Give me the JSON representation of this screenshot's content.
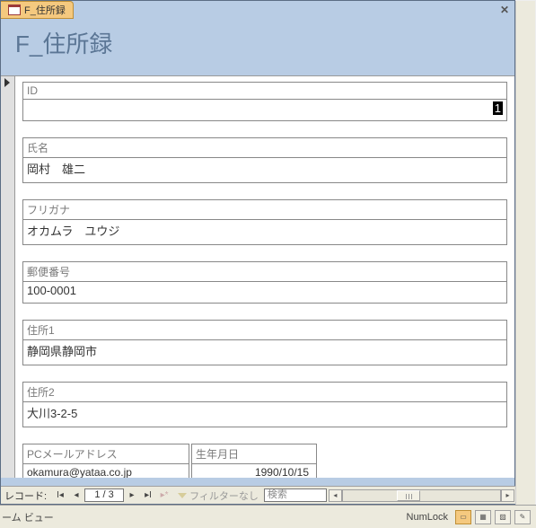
{
  "tab": {
    "title": "F_住所録"
  },
  "form": {
    "title": "F_住所録"
  },
  "fields": {
    "id": {
      "label": "ID",
      "value": "1"
    },
    "name": {
      "label": "氏名",
      "value": "岡村　雄二"
    },
    "furigana": {
      "label": "フリガナ",
      "value": "オカムラ　ユウジ"
    },
    "postal": {
      "label": "郵便番号",
      "value": "100-0001"
    },
    "addr1": {
      "label": "住所1",
      "value": "静岡県静岡市"
    },
    "addr2": {
      "label": "住所2",
      "value": "大川3-2-5"
    },
    "email": {
      "label": "PCメールアドレス",
      "value": "okamura@yataa.co.jp"
    },
    "dob": {
      "label": "生年月日",
      "value": "1990/10/15"
    }
  },
  "nav": {
    "label": "レコード:",
    "counter": "1 / 3",
    "filter": "フィルターなし",
    "search": "検索"
  },
  "status": {
    "view": "ーム ビュー",
    "numlock": "NumLock"
  }
}
